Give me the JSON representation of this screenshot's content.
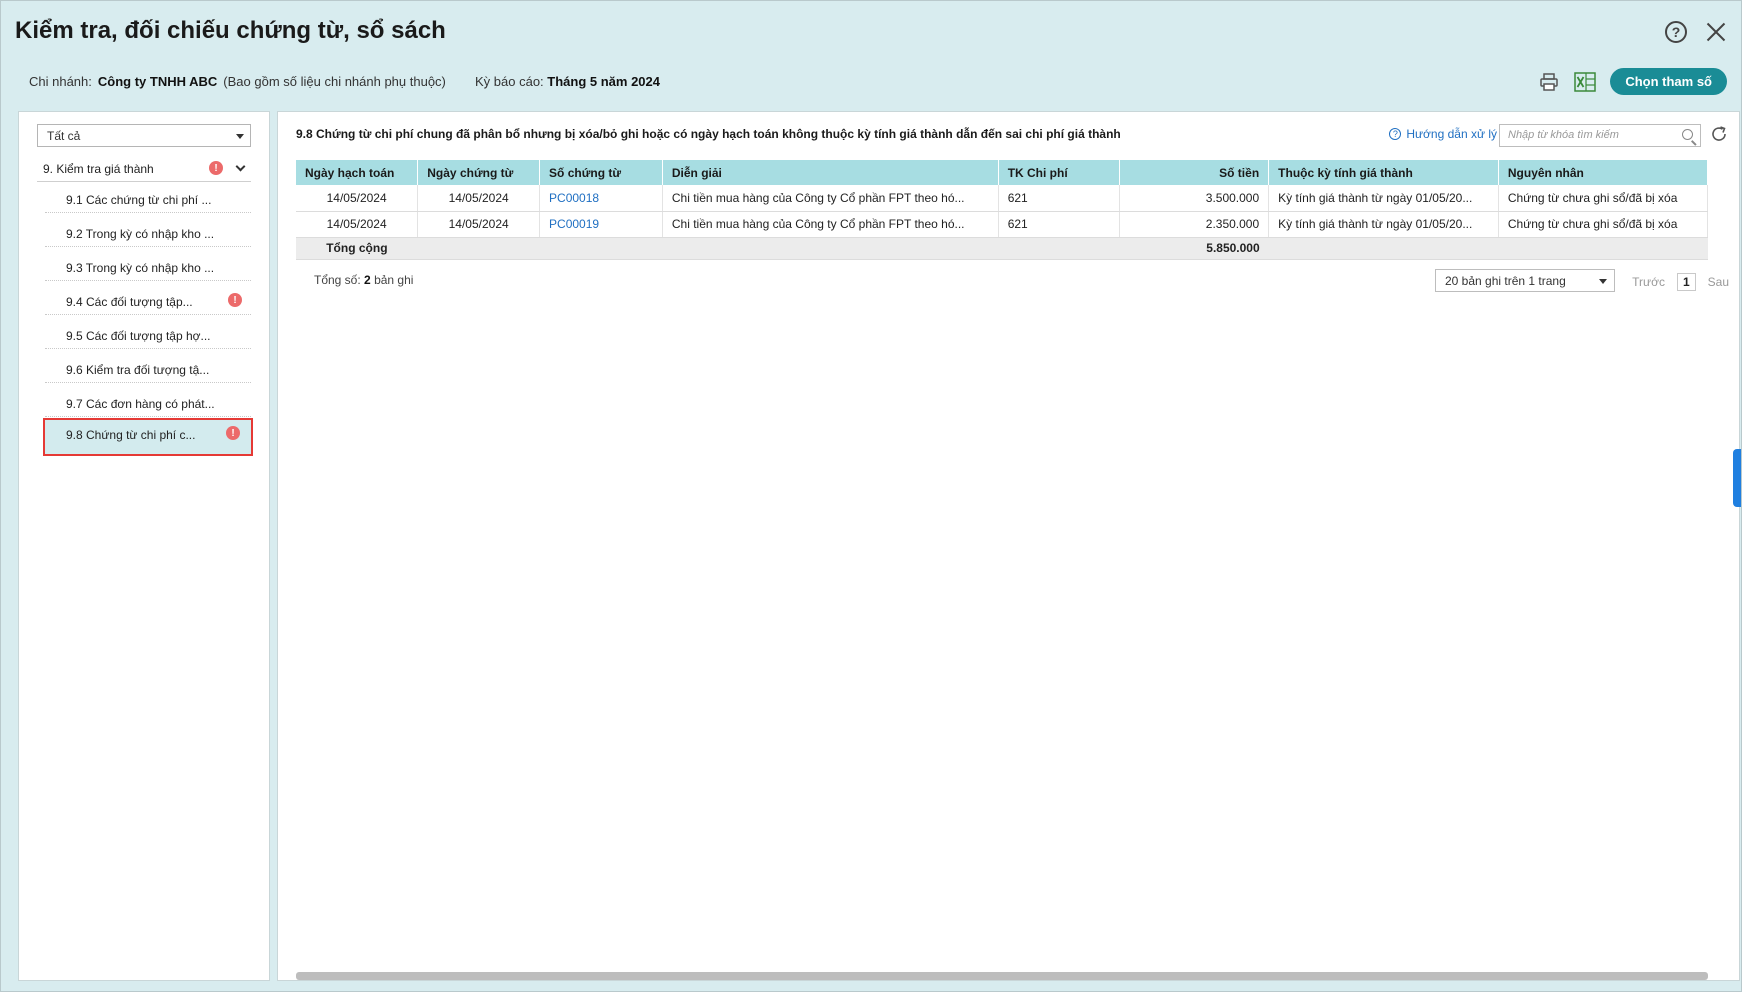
{
  "header": {
    "title": "Kiểm tra, đối chiếu chứng từ, sổ sách",
    "branch_label": "Chi nhánh:",
    "branch_value": "Công ty TNHH ABC",
    "branch_note": "(Bao gồm số liệu chi nhánh phụ thuộc)",
    "period_label": "Kỳ báo cáo:",
    "period_value": "Tháng 5 năm 2024",
    "choose_params_label": "Chọn tham số"
  },
  "sidebar": {
    "filter_value": "Tất cả",
    "group_label": "9. Kiểm tra giá thành",
    "items": [
      {
        "label": "9.1 Các chứng từ chi phí ..."
      },
      {
        "label": "9.2 Trong kỳ có nhập kho ..."
      },
      {
        "label": "9.3 Trong kỳ có nhập kho ..."
      },
      {
        "label": "9.4 Các đối tượng tập..."
      },
      {
        "label": "9.5 Các đối tượng tập hợ..."
      },
      {
        "label": "9.6 Kiểm tra đối tượng tậ..."
      },
      {
        "label": "9.7 Các đơn hàng có phát..."
      },
      {
        "label": "9.8 Chứng từ chi phí c..."
      }
    ]
  },
  "main": {
    "section_title": "9.8 Chứng từ chi phí chung đã phân bổ nhưng bị xóa/bỏ ghi hoặc có ngày hạch toán không thuộc kỳ tính giá thành dẫn đến sai chi phí giá thành",
    "guide_label": "Hướng dẫn xử lý",
    "search_placeholder": "Nhập từ khóa tìm kiếm",
    "columns": [
      "Ngày hạch toán",
      "Ngày chứng từ",
      "Số chứng từ",
      "Diễn giải",
      "TK Chi phí",
      "Số tiền",
      "Thuộc kỳ tính giá thành",
      "Nguyên nhân"
    ],
    "rows": [
      [
        "14/05/2024",
        "14/05/2024",
        "PC00018",
        "Chi tiền mua hàng của Công ty Cổ phần FPT theo hó...",
        "621",
        "3.500.000",
        "Kỳ tính giá thành từ ngày 01/05/20...",
        "Chứng từ chưa ghi sổ/đã bị xóa"
      ],
      [
        "14/05/2024",
        "14/05/2024",
        "PC00019",
        "Chi tiền mua hàng của Công ty Cổ phần FPT theo hó...",
        "621",
        "2.350.000",
        "Kỳ tính giá thành từ ngày 01/05/20...",
        "Chứng từ chưa ghi sổ/đã bị xóa"
      ]
    ],
    "total_label": "Tổng cộng",
    "total_value": "5.850.000",
    "count_prefix": "Tổng số:",
    "count_value": "2",
    "count_suffix": "bản ghi",
    "page_size": "20 bản ghi trên 1 trang",
    "prev_label": "Trước",
    "page_number": "1",
    "next_label": "Sau"
  },
  "colors": {
    "accent": "#1a8c96",
    "header_bg": "#d8ecef",
    "table_header": "#a7dde2",
    "link": "#1f6fc2",
    "warning": "#ec6a6a",
    "active_border": "#e53935"
  }
}
